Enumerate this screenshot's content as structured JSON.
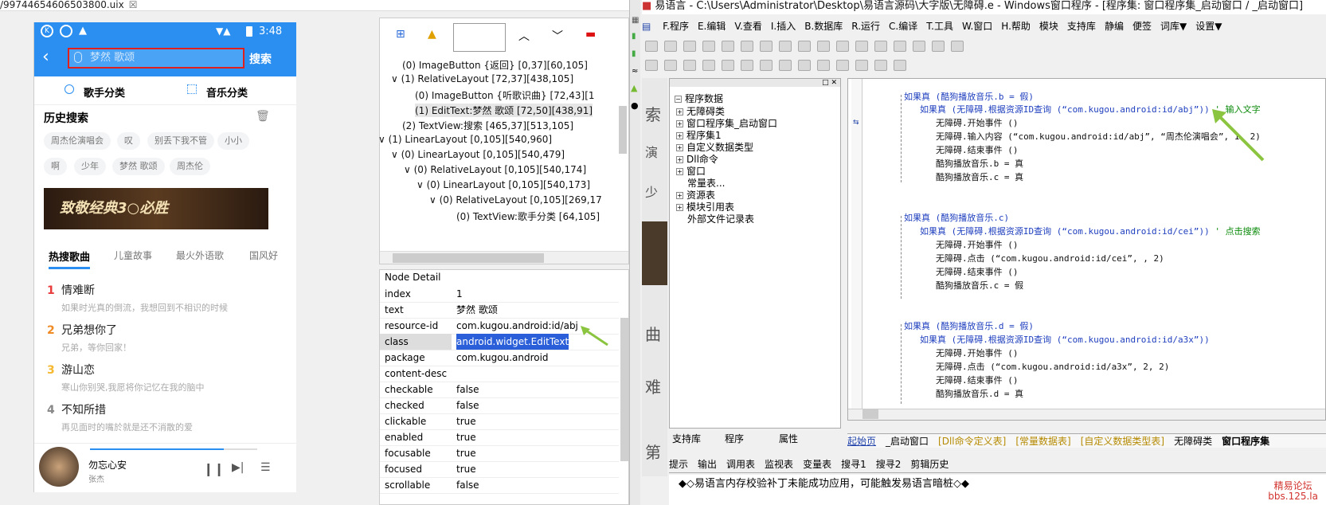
{
  "uix": {
    "file": "/99744654606503800.uix",
    "close": "☒"
  },
  "phone": {
    "time": "3:48",
    "search_placeholder": "梦然 歌颂",
    "search_button": "搜索",
    "cat_singer": "歌手分类",
    "cat_music": "音乐分类",
    "history_title": "历史搜索",
    "chips": [
      "周杰伦演唱会",
      "叹",
      "别丢下我不管",
      "小小",
      "啊",
      "少年",
      "梦然 歌颂",
      "周杰伦"
    ],
    "banner_text": "致敬经典3○必胜",
    "tabs": [
      "热搜歌曲",
      "儿童故事",
      "最火外语歌",
      "国风好"
    ],
    "songs": [
      {
        "n": "1",
        "t": "情难断",
        "s": "如果时光真的倒流，我想回到不相识的时候",
        "c": "#e83c3c"
      },
      {
        "n": "2",
        "t": "兄弟想你了",
        "s": "兄弟，等你回家！",
        "c": "#f08a24"
      },
      {
        "n": "3",
        "t": "游山恋",
        "s": "寒山你别哭,我愿将你记忆在我的脑中",
        "c": "#f5b82e"
      },
      {
        "n": "4",
        "t": "不知所措",
        "s": "再见面时的嘴於就是还不消散的爱",
        "c": "#888"
      }
    ],
    "player_song": "勿忘心安",
    "player_artist": "张杰",
    "progress": 0.8
  },
  "tree": {
    "nodes": [
      "(0) ImageButton {返回} [0,37][60,105]",
      "(1) RelativeLayout [72,37][438,105]",
      "(0) ImageButton {听歌识曲} [72,43][1",
      "(1) EditText:梦然 歌颂 [72,50][438,91]",
      "(2) TextView:搜索 [465,37][513,105]",
      "(1) LinearLayout [0,105][540,960]",
      "(0) LinearLayout [0,105][540,479]",
      "(0) RelativeLayout [0,105][540,174]",
      "(0) LinearLayout [0,105][540,173]",
      "(0) RelativeLayout [0,105][269,17",
      "(0) TextView:歌手分类 [64,105]"
    ]
  },
  "detail": {
    "title": "Node Detail",
    "rows": [
      [
        "index",
        "1"
      ],
      [
        "text",
        "梦然 歌颂"
      ],
      [
        "resource-id",
        "com.kugou.android:id/abj"
      ],
      [
        "class",
        "android.widget.EditText"
      ],
      [
        "package",
        "com.kugou.android"
      ],
      [
        "content-desc",
        ""
      ],
      [
        "checkable",
        "false"
      ],
      [
        "checked",
        "false"
      ],
      [
        "clickable",
        "true"
      ],
      [
        "enabled",
        "true"
      ],
      [
        "focusable",
        "true"
      ],
      [
        "focused",
        "true"
      ],
      [
        "scrollable",
        "false"
      ]
    ]
  },
  "editor": {
    "title": "易语言 - C:\\Users\\Administrator\\Desktop\\易语言源码\\大字版\\无障碍.e - Windows窗口程序 - [程序集: 窗口程序集_启动窗口 / _启动窗口]",
    "menu": [
      "F.程序",
      "E.编辑",
      "V.查看",
      "I.插入",
      "B.数据库",
      "R.运行",
      "C.编译",
      "T.工具",
      "W.窗口",
      "H.帮助",
      "模块",
      "支持库",
      "静编",
      "便签",
      "词库▼",
      "设置▼"
    ],
    "sidebar": [
      "程序数据",
      "无障碍类",
      "窗口程序集_启动窗口",
      "程序集1",
      "自定义数据类型",
      "Dll命令",
      "窗口",
      "常量表...",
      "资源表",
      "模块引用表",
      "外部文件记录表"
    ],
    "sidetabs": [
      "支持库",
      "程序",
      "属性"
    ],
    "code": [
      {
        "t": "如果真 (酷狗播放音乐.b = 假)",
        "k": "head"
      },
      {
        "t": "如果真 (无障碍.根据资源ID查询 (“com.kugou.android:id/abj”))",
        "c": "' 输入文字",
        "k": "cond"
      },
      {
        "t": "无障碍.开始事件 ()",
        "k": "body"
      },
      {
        "t": "无障碍.输入内容 (“com.kugou.android:id/abj”, “周杰伦演唱会”, 1, 2)",
        "k": "body"
      },
      {
        "t": "无障碍.结束事件 ()",
        "k": "body"
      },
      {
        "t": "酷狗播放音乐.b = 真",
        "k": "body"
      },
      {
        "t": "酷狗播放音乐.c = 真",
        "k": "body"
      },
      {
        "t": "如果真 (酷狗播放音乐.c)",
        "k": "head"
      },
      {
        "t": "如果真 (无障碍.根据资源ID查询 (“com.kugou.android:id/cei”))",
        "c": "' 点击搜索",
        "k": "cond"
      },
      {
        "t": "无障碍.开始事件 ()",
        "k": "body"
      },
      {
        "t": "无障碍.点击 (“com.kugou.android:id/cei”, , 2)",
        "k": "body"
      },
      {
        "t": "无障碍.结束事件 ()",
        "k": "body"
      },
      {
        "t": "酷狗播放音乐.c = 假",
        "k": "body"
      },
      {
        "t": "如果真 (酷狗播放音乐.d = 假)",
        "k": "head"
      },
      {
        "t": "如果真 (无障碍.根据资源ID查询 (“com.kugou.android:id/a3x”))",
        "k": "cond"
      },
      {
        "t": "无障碍.开始事件 ()",
        "k": "body"
      },
      {
        "t": "无障碍.点击 (“com.kugou.android:id/a3x”, 2, 2)",
        "k": "body"
      },
      {
        "t": "无障碍.结束事件 ()",
        "k": "body"
      },
      {
        "t": "酷狗播放音乐.d = 真",
        "k": "body"
      }
    ],
    "code_tabs": [
      "起始页",
      "_启动窗口",
      "[Dll命令定义表]",
      "[常量数据表]",
      "[自定义数据类型表]",
      "无障碍类",
      "窗口程序集"
    ],
    "out_tabs": [
      "提示",
      "输出",
      "调用表",
      "监视表",
      "变量表",
      "搜寻1",
      "搜寻2",
      "剪辑历史"
    ],
    "message": "◆◇易语言内存校验补丁未能成功应用，可能触发易语言暗桩◇◆",
    "strip_chars": [
      "索",
      "演",
      "少",
      "曲",
      "难",
      "第"
    ]
  },
  "watermark": {
    "l1": "精易论坛",
    "l2": "bbs.125.la"
  }
}
